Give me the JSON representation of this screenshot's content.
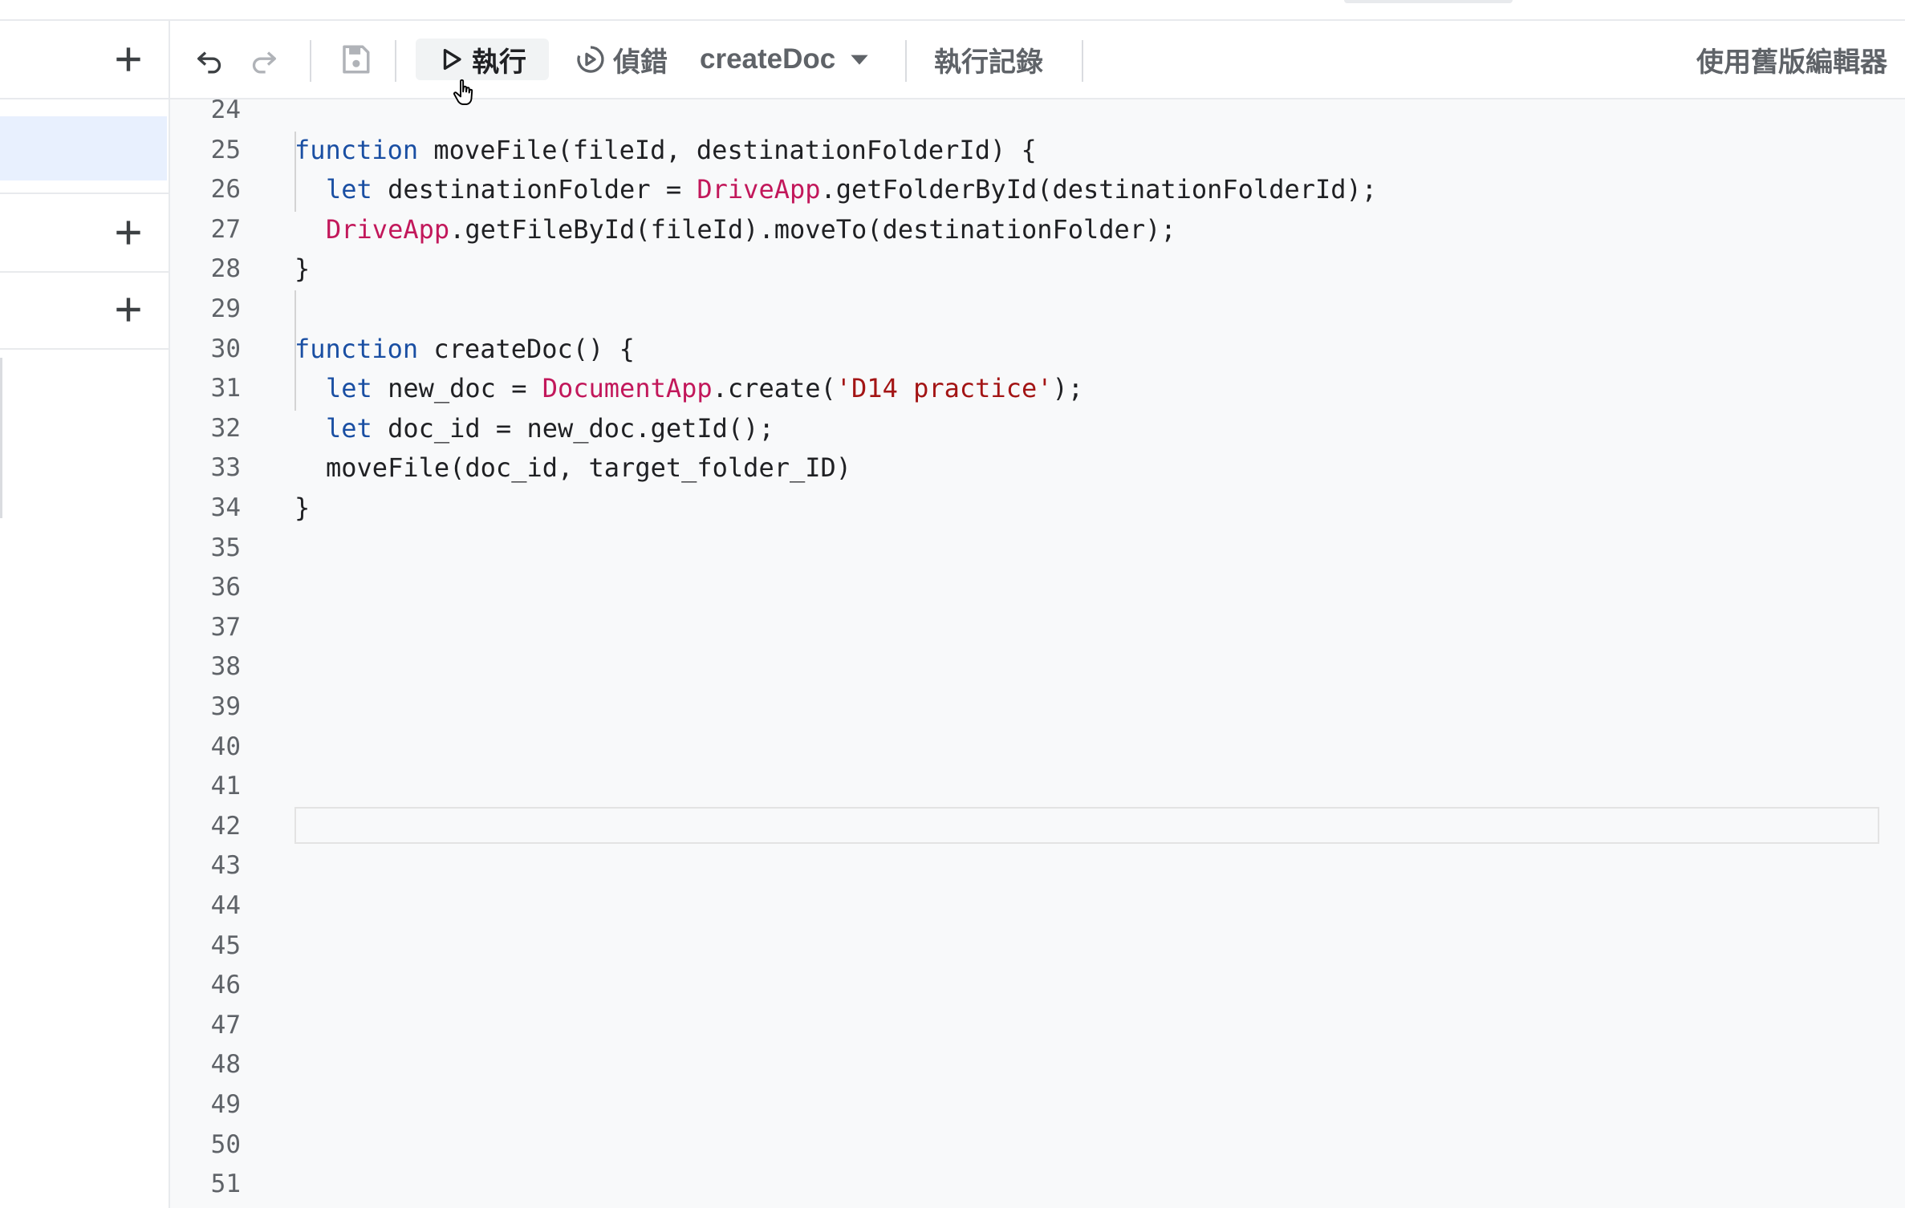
{
  "toolbar": {
    "run_label": "執行",
    "debug_label": "偵錯",
    "function_select": "createDoc",
    "execution_log_label": "執行記錄",
    "legacy_editor_label": "使用舊版編輯器"
  },
  "editor": {
    "lines": [
      {
        "n": "24"
      },
      {
        "n": "25",
        "indent": 0,
        "tokens": [
          {
            "t": "function",
            "c": "kw"
          },
          {
            "t": " moveFile(fileId, destinationFolderId) {"
          }
        ]
      },
      {
        "n": "26",
        "indent": 1,
        "tokens": [
          {
            "t": "let",
            "c": "kw"
          },
          {
            "t": " destinationFolder = "
          },
          {
            "t": "DriveApp",
            "c": "cls"
          },
          {
            "t": ".getFolderById(destinationFolderId);"
          }
        ]
      },
      {
        "n": "27",
        "indent": 1,
        "tokens": [
          {
            "t": "DriveApp",
            "c": "cls"
          },
          {
            "t": ".getFileById(fileId).moveTo(destinationFolder);"
          }
        ]
      },
      {
        "n": "28",
        "indent": 0,
        "tokens": [
          {
            "t": "}"
          }
        ]
      },
      {
        "n": "29"
      },
      {
        "n": "30",
        "indent": 0,
        "tokens": [
          {
            "t": "function",
            "c": "kw"
          },
          {
            "t": " createDoc() {"
          }
        ]
      },
      {
        "n": "31",
        "indent": 1,
        "tokens": [
          {
            "t": "let",
            "c": "kw"
          },
          {
            "t": " new_doc = "
          },
          {
            "t": "DocumentApp",
            "c": "cls"
          },
          {
            "t": ".create("
          },
          {
            "t": "'D14 practice'",
            "c": "str"
          },
          {
            "t": ");"
          }
        ]
      },
      {
        "n": "32",
        "indent": 1,
        "tokens": [
          {
            "t": "let",
            "c": "kw"
          },
          {
            "t": " doc_id = new_doc.getId();"
          }
        ]
      },
      {
        "n": "33",
        "indent": 1,
        "tokens": [
          {
            "t": "moveFile(doc_id, target_folder_ID)"
          }
        ]
      },
      {
        "n": "34",
        "indent": 0,
        "tokens": [
          {
            "t": "}"
          }
        ]
      },
      {
        "n": "35"
      },
      {
        "n": "36"
      },
      {
        "n": "37"
      },
      {
        "n": "38"
      },
      {
        "n": "39"
      },
      {
        "n": "40"
      },
      {
        "n": "41"
      },
      {
        "n": "42"
      },
      {
        "n": "43"
      },
      {
        "n": "44"
      },
      {
        "n": "45"
      },
      {
        "n": "46"
      },
      {
        "n": "47"
      },
      {
        "n": "48"
      },
      {
        "n": "49"
      },
      {
        "n": "50"
      },
      {
        "n": "51"
      }
    ]
  }
}
